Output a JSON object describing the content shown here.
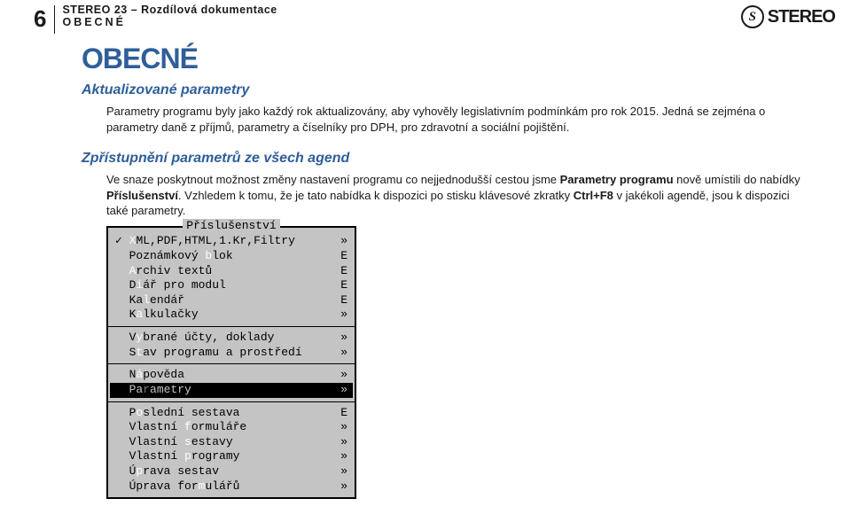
{
  "header": {
    "page_number": "6",
    "line1": "STEREO 23 – Rozdílová dokumentace",
    "line2": "OBECNÉ",
    "logo_glyph": "S",
    "logo_text": "STEREO"
  },
  "content": {
    "h1": "OBECNÉ",
    "section1": {
      "title": "Aktualizované parametry",
      "para": "Parametry programu byly jako každý rok aktualizovány, aby vyhověly legislativním podmínkám pro rok 2015. Jedná se zejména o parametry daně z příjmů, parametry a číselníky pro DPH, pro zdravotní a sociální pojištění."
    },
    "section2": {
      "title": "Zpřístupnění parametrů ze všech agend",
      "para_pre": "Ve snaze poskytnout možnost změny nastavení programu co nejjednodušší cestou jsme ",
      "para_bold1": "Parametry programu",
      "para_mid": " nově umístili do nabídky ",
      "para_bold2": "Příslušenství",
      "para_post1": ". Vzhledem k tomu, že je tato nabídka k dispozici po stisku klávesové zkratky ",
      "para_bold3": "Ctrl+F8",
      "para_post2": " v jakékoli agendě, jsou k dispozici také parametry."
    }
  },
  "menu": {
    "title": "Příslušenství",
    "items": [
      {
        "label_pre": "",
        "ul": "X",
        "label_post": "ML,PDF,HTML,1.Kr,Filtry",
        "hint": "»",
        "check": true
      },
      {
        "label_pre": "Poznámkový ",
        "ul": "b",
        "label_post": "lok",
        "hint": "E"
      },
      {
        "label_pre": "",
        "ul": "A",
        "label_post": "rchiv textů",
        "hint": "E"
      },
      {
        "label_pre": "D",
        "ul": "i",
        "label_post": "ář pro modul",
        "hint": "E"
      },
      {
        "label_pre": "Ka",
        "ul": "l",
        "label_post": "endář",
        "hint": "E"
      },
      {
        "label_pre": "K",
        "ul": "a",
        "label_post": "lkulačky",
        "hint": "»"
      }
    ],
    "items2": [
      {
        "label_pre": "V",
        "ul": "y",
        "label_post": "brané účty, doklady",
        "hint": "»"
      },
      {
        "label_pre": "S",
        "ul": "t",
        "label_post": "av programu a prostředí",
        "hint": "»"
      }
    ],
    "items3": [
      {
        "label_pre": "N",
        "ul": "á",
        "label_post": "pověda",
        "hint": "»"
      },
      {
        "label_pre": "Pa",
        "ul": "r",
        "label_post": "ametry",
        "hint": "»",
        "selected": true
      }
    ],
    "items4": [
      {
        "label_pre": "P",
        "ul": "o",
        "label_post": "slední sestava",
        "hint": "E"
      },
      {
        "label_pre": "Vlastní ",
        "ul": "f",
        "label_post": "ormuláře",
        "hint": "»"
      },
      {
        "label_pre": "Vlastní ",
        "ul": "s",
        "label_post": "estavy",
        "hint": "»"
      },
      {
        "label_pre": "Vlastní ",
        "ul": "p",
        "label_post": "rogramy",
        "hint": "»"
      },
      {
        "label_pre": "Ú",
        "ul": "p",
        "label_post": "rava sestav",
        "hint": "»"
      },
      {
        "label_pre": "Úprava for",
        "ul": "m",
        "label_post": "ulářů",
        "hint": "»"
      }
    ]
  }
}
